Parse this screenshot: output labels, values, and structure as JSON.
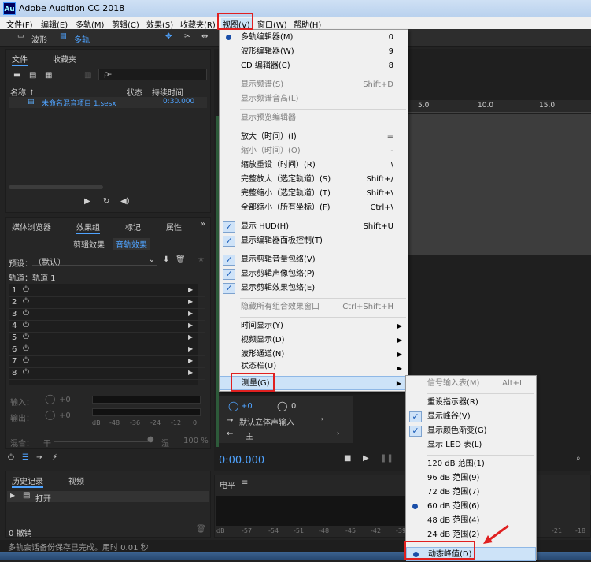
{
  "window": {
    "title": "Adobe Audition CC 2018",
    "logo": "Au"
  },
  "menubar": [
    "文件(F)",
    "编辑(E)",
    "多轨(M)",
    "剪辑(C)",
    "效果(S)",
    "收藏夹(R)",
    "视图(V)",
    "窗口(W)",
    "帮助(H)"
  ],
  "toolbar": {
    "waveform": "波形",
    "multitrack": "多轨"
  },
  "files_panel": {
    "tab_files": "文件",
    "tab_favorites": "收藏夹",
    "search_placeholder": "ρ-",
    "col_name": "名称 ↑",
    "col_status": "状态",
    "col_duration": "持续时间",
    "item_name": "未命名混音项目 1.sesx",
    "item_duration": "0:30.000"
  },
  "effects_panel": {
    "tab_media": "媒体浏览器",
    "tab_effects": "效果组",
    "tab_markers": "标记",
    "tab_props": "属性",
    "clip_effects": "剪辑效果",
    "track_effects": "音轨效果",
    "preset_label": "预设：",
    "preset_value": "（默认）",
    "track_label": "轨道：轨道 1",
    "slots": [
      "1",
      "2",
      "3",
      "4",
      "5",
      "6",
      "7",
      "8",
      "9"
    ],
    "input_label": "输入：",
    "output_label": "输出：",
    "mix_label": "混合：",
    "gain_in": "+0",
    "gain_out": "+0",
    "dry": "干",
    "wet": "湿",
    "mix_pct": "100 %",
    "meter_ticks": [
      "dB",
      "-48",
      "-36",
      "-24",
      "-12",
      "0"
    ]
  },
  "editor": {
    "ruler": [
      "5.0",
      "10.0",
      "15.0"
    ],
    "time": "0:00.000",
    "input_label": "默认立体声输入",
    "main_label": "主",
    "vol": "+0",
    "pan": "0"
  },
  "history": {
    "tab_history": "历史记录",
    "tab_video": "视频",
    "open_item": "打开",
    "undo_count": "0 撤销"
  },
  "levels": {
    "title": "电平",
    "ticks": [
      "dB",
      "-57",
      "-54",
      "-51",
      "-48",
      "-45",
      "-42",
      "-39",
      "-21",
      "-18"
    ]
  },
  "status": "多轨会话备份保存已完成。用时 0.01 秒",
  "view_menu": {
    "items": [
      {
        "label": "多轨编辑器(M)",
        "shortcut": "0",
        "mark": "dot"
      },
      {
        "label": "波形编辑器(W)",
        "shortcut": "9"
      },
      {
        "label": "CD 编辑器(C)",
        "shortcut": "8"
      },
      {
        "label": "显示频谱(S)",
        "shortcut": "Shift+D",
        "disabled": true
      },
      {
        "label": "显示频谱音高(L)",
        "disabled": true
      },
      {
        "label": "显示预览编辑器",
        "disabled": true
      },
      {
        "label": "放大（时间）(I)",
        "shortcut": "="
      },
      {
        "label": "缩小（时间）(O)",
        "shortcut": "-",
        "disabled": true
      },
      {
        "label": "缩放重设（时间）(R)",
        "shortcut": "\\"
      },
      {
        "label": "完整放大（选定轨道）(S)",
        "shortcut": "Shift+/"
      },
      {
        "label": "完整缩小（选定轨道）(T)",
        "shortcut": "Shift+\\"
      },
      {
        "label": "全部缩小（所有坐标）(F)",
        "shortcut": "Ctrl+\\"
      },
      {
        "label": "显示 HUD(H)",
        "shortcut": "Shift+U",
        "mark": "check"
      },
      {
        "label": "显示编辑器面板控制(T)",
        "mark": "check"
      },
      {
        "label": "显示剪辑音量包络(V)",
        "mark": "check"
      },
      {
        "label": "显示剪辑声像包络(P)",
        "mark": "check"
      },
      {
        "label": "显示剪辑效果包络(E)",
        "mark": "check"
      },
      {
        "label": "隐藏所有组合效果窗口",
        "shortcut": "Ctrl+Shift+H",
        "disabled": true
      },
      {
        "label": "时间显示(Y)",
        "sub": true
      },
      {
        "label": "视频显示(D)",
        "sub": true
      },
      {
        "label": "波形通道(N)",
        "sub": true
      },
      {
        "label": "状态栏(U)",
        "sub": true
      },
      {
        "label": "测量(G)",
        "sub": true
      }
    ]
  },
  "metering_menu": {
    "items": [
      {
        "label": "信号输入表(M)",
        "shortcut": "Alt+I",
        "disabled": true
      },
      {
        "label": "重设指示器(R)"
      },
      {
        "label": "显示峰谷(V)",
        "mark": "check"
      },
      {
        "label": "显示颜色渐变(G)",
        "mark": "check"
      },
      {
        "label": "显示 LED 表(L)"
      },
      {
        "label": "120 dB 范围(1)"
      },
      {
        "label": "96 dB 范围(9)"
      },
      {
        "label": "72 dB 范围(7)"
      },
      {
        "label": "60 dB 范围(6)",
        "mark": "dot"
      },
      {
        "label": "48 dB 范围(4)"
      },
      {
        "label": "24 dB 范围(2)"
      },
      {
        "label": "动态峰值(D)",
        "mark": "dot"
      }
    ]
  }
}
